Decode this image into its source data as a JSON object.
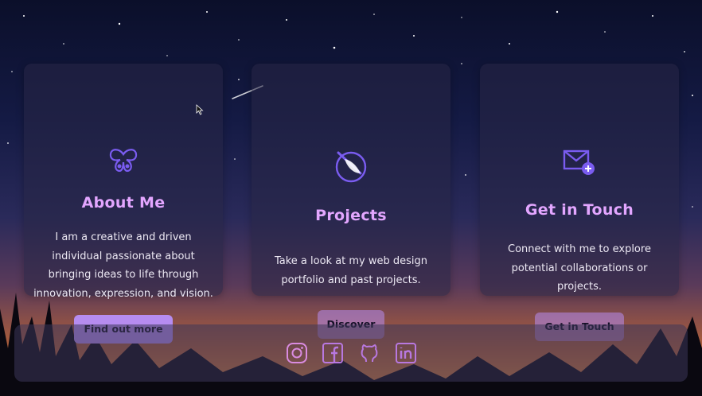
{
  "cards": [
    {
      "icon": "butterfly-icon",
      "title": "About Me",
      "text_lines": [
        "I am a creative and driven",
        "individual passionate about",
        "bringing ideas to life through",
        "innovation, expression, and vision."
      ],
      "button": "Find out more"
    },
    {
      "icon": "quill-icon",
      "title": "Projects",
      "text_lines": [
        "Take a look at my web design",
        "portfolio and past projects."
      ],
      "button": "Discover"
    },
    {
      "icon": "envelope-icon",
      "title": "Get in Touch",
      "text_lines": [
        "Connect with me to explore",
        "potential collaborations or",
        "projects."
      ],
      "button": "Get in Touch"
    }
  ],
  "footer": {
    "social_icons": [
      "instagram-icon",
      "facebook-icon",
      "github-icon",
      "linkedin-icon"
    ]
  },
  "colors": {
    "accent": "#b68cf0",
    "title": "#e3a6ff",
    "icon": "#7a5cf0"
  }
}
